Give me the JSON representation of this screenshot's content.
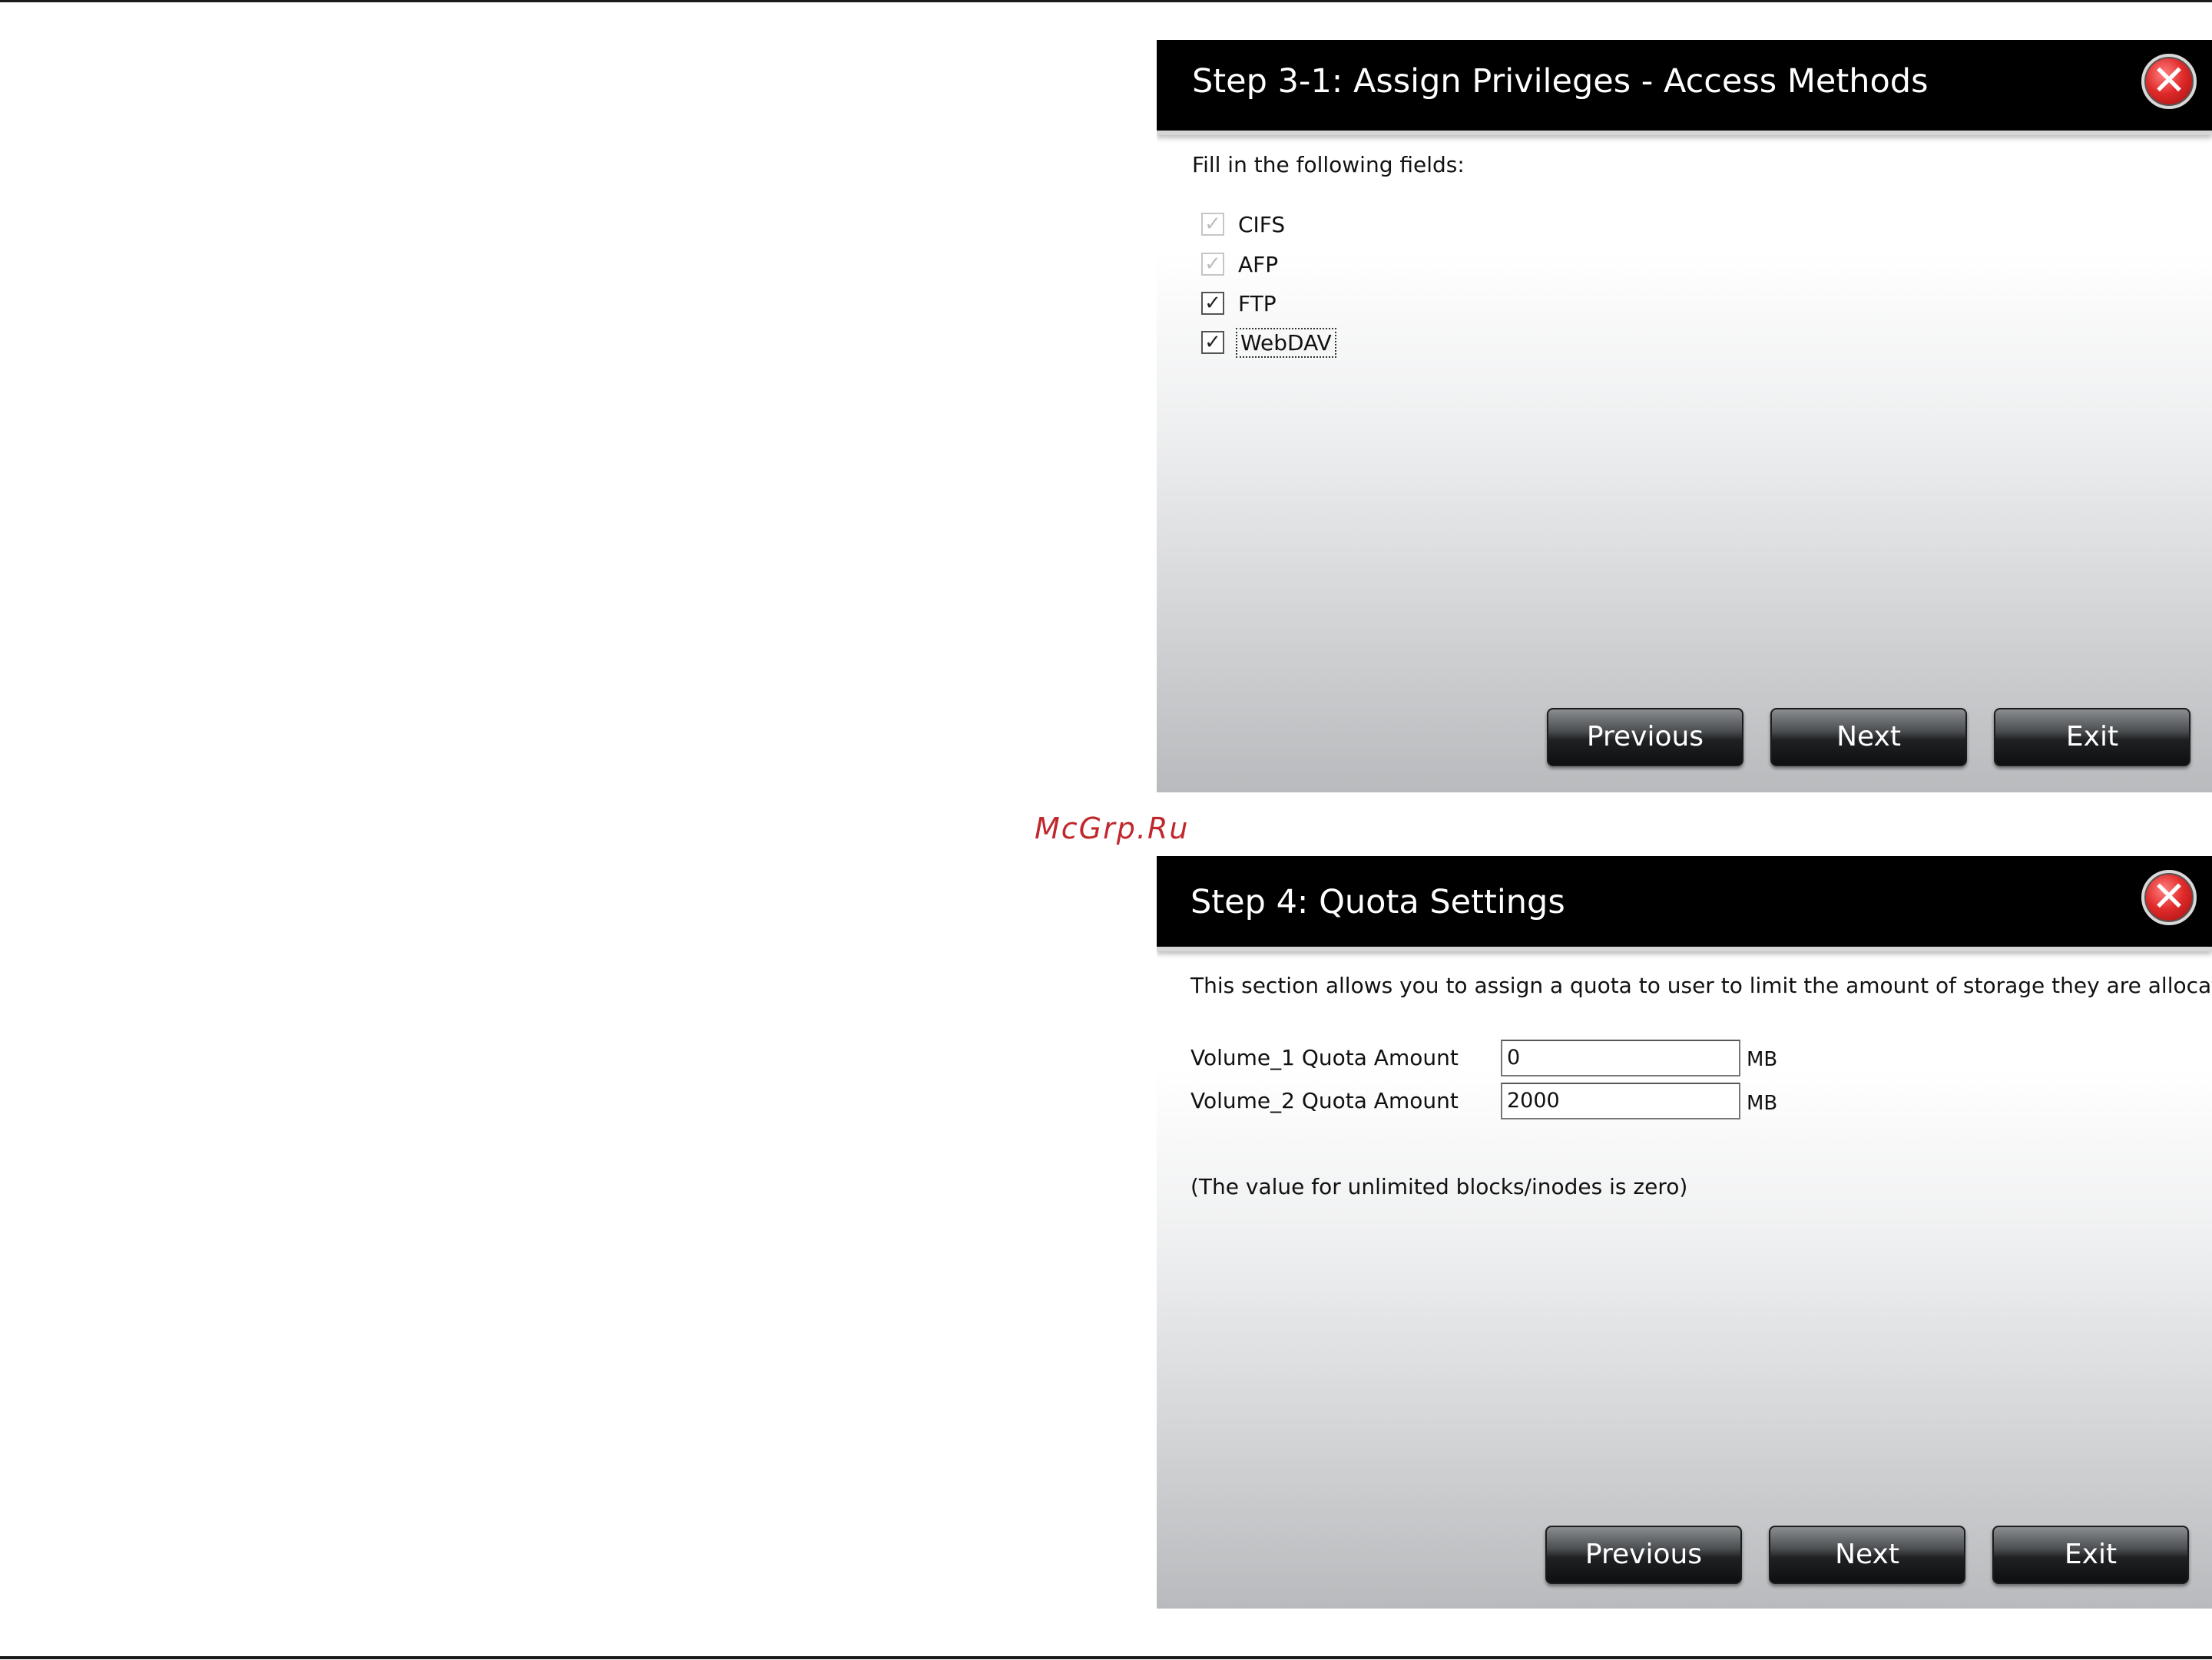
{
  "watermark": "McGrp.Ru",
  "dialog_access": {
    "title": "Step 3-1: Assign Privileges - Access Methods",
    "instruction": "Fill in the following fields:",
    "options": [
      {
        "label": "CIFS",
        "checked": true,
        "disabled": true
      },
      {
        "label": "AFP",
        "checked": true,
        "disabled": true
      },
      {
        "label": "FTP",
        "checked": true,
        "disabled": false
      },
      {
        "label": "WebDAV",
        "checked": true,
        "disabled": false,
        "focused": true
      }
    ],
    "buttons": {
      "previous": "Previous",
      "next": "Next",
      "exit": "Exit"
    }
  },
  "dialog_quota": {
    "title": "Step 4: Quota Settings",
    "description": "This section allows you to assign a quota to user to limit the amount of storage they are allocated.",
    "fields": [
      {
        "label": "Volume_1 Quota Amount",
        "value": "0",
        "unit": "MB"
      },
      {
        "label": "Volume_2 Quota Amount",
        "value": "2000",
        "unit": "MB"
      }
    ],
    "note": "(The value for unlimited blocks/inodes is zero)",
    "buttons": {
      "previous": "Previous",
      "next": "Next",
      "exit": "Exit"
    }
  }
}
